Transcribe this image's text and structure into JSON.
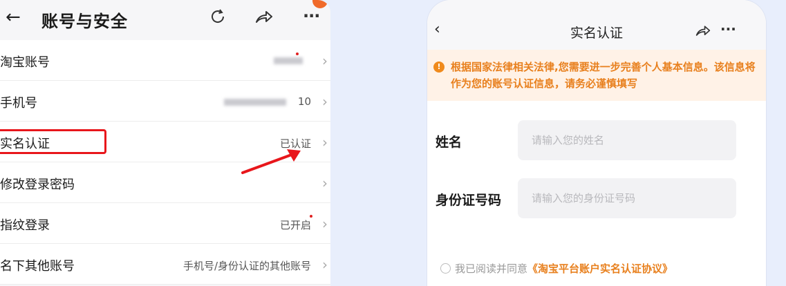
{
  "left": {
    "title": "账号与安全",
    "rows": [
      {
        "label": "淘宝账号",
        "value": "",
        "blurred": true
      },
      {
        "label": "手机号",
        "value": "10",
        "blurred": true
      },
      {
        "label": "实名认证",
        "value": "已认证",
        "highlighted": true
      },
      {
        "label": "修改登录密码",
        "value": ""
      },
      {
        "label": "指纹登录",
        "value": "已开启",
        "dot": true
      },
      {
        "label": "名下其他账号",
        "value": "手机号/身份认证的其他账号"
      }
    ]
  },
  "right": {
    "title": "实名认证",
    "notice": "根据国家法律相关法律,您需要进一步完善个人基本信息。该信息将作为您的账号认证信息，请务必谨慎填写",
    "notice_icon": "!",
    "name_label": "姓名",
    "name_placeholder": "请输入您的姓名",
    "id_label": "身份证号码",
    "id_placeholder": "请输入您的身份证号码",
    "agree_prefix": "我已阅读并同意",
    "agree_link": "《淘宝平台账户实名认证协议》"
  },
  "colors": {
    "accent_orange": "#e8801e",
    "highlight_red": "#e8161b",
    "background": "#e8eefc"
  }
}
